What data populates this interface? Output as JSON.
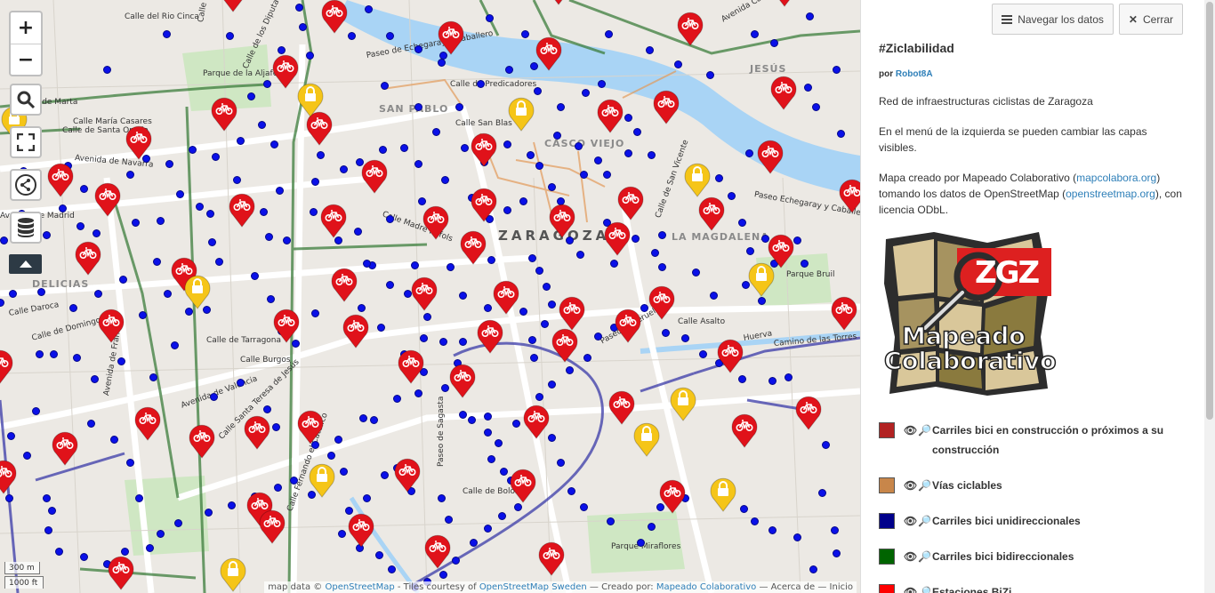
{
  "map": {
    "city_label": "ZARAGOZA",
    "districts": [
      "SAN PABLO",
      "CASCO VIEJO",
      "JESÚS",
      "LA MAGDALENA",
      "DELICIAS"
    ],
    "streets": [
      "Calle del Rio Cinca",
      "Calle del Reino",
      "Parque de la Aljafería",
      "Calle de los Diputados",
      "Paseo de Echegaray y Caballero",
      "Calle de Predicadores",
      "Calle San Blas",
      "Avenida Cataluña",
      "Calle de Marta",
      "Calle María Casares",
      "Calle de Santa Orosia",
      "Avenida de Navarra",
      "Calle Madre Rafols",
      "Calle de San Vicente",
      "Calle Asalto",
      "Paseo de Teruel",
      "Calle de Tarragona",
      "Calle Burgos",
      "Avenida de Valencia",
      "Calle Santa Teresa de Jesús",
      "Paseo de Sagasta",
      "Calle de Bolonia",
      "Parque Miraflores",
      "Calle Fernando el Católico",
      "Avenida de Francia",
      "Calle de Domingo Ram",
      "Calle Daroca",
      "Avenida de Madrid",
      "Paseo Echegaray y Caballero",
      "Camino de las Torres",
      "Parque Bruil",
      "Huerva"
    ],
    "scale_metric": "300 m",
    "scale_imperial": "1000 ft",
    "attribution_prefix": "map data © ",
    "attribution_osm": "OpenStreetMap",
    "attribution_tiles": " - Tiles courtesy of ",
    "attribution_sweden": "OpenStreetMap Sweden",
    "attribution_created": " — Creado por: ",
    "attribution_mapeado": "Mapeado Colaborativo",
    "attribution_end": " — Acerca de — Inicio"
  },
  "controls": {
    "zoom_in": "+",
    "zoom_out": "−"
  },
  "panel": {
    "browse_label": "Navegar los datos",
    "close_label": "Cerrar",
    "title": "#Ziclabilidad",
    "author_prefix": "por ",
    "author": "Robot8A",
    "desc1": "Red de infraestructuras ciclistas de Zaragoza",
    "desc2": "En el menú de la izquierda se pueden cambiar las capas visibles.",
    "desc3a": "Mapa creado por Mapeado Colaborativo (",
    "desc3_link1": "mapcolabora.org",
    "desc3b": ") tomando los datos de OpenStreetMap (",
    "desc3_link2": "openstreetmap.org",
    "desc3c": "), con licencia ODbL.",
    "logo_text1": "Mapeado",
    "logo_text2": "Colaborativo",
    "logo_badge": "ZGZ",
    "legend": [
      {
        "label": "Carriles bici en construcción o próximos a su construcción",
        "color": "#b22222"
      },
      {
        "label": "Vías ciclables",
        "color": "#c8864a"
      },
      {
        "label": "Carriles bici unidireccionales",
        "color": "#00008b"
      },
      {
        "label": "Carriles bici bidireccionales",
        "color": "#006400"
      },
      {
        "label": "Estaciones BiZi",
        "color": "#ff0000"
      }
    ]
  },
  "colors": {
    "bizi_marker": "#e0121a",
    "parking_marker": "#f5c518",
    "river": "#a9d4f5",
    "bidirectional": "#3c7d3c",
    "unidirectional": "#3a3aa8",
    "stop_dot": "#0a10e8"
  }
}
